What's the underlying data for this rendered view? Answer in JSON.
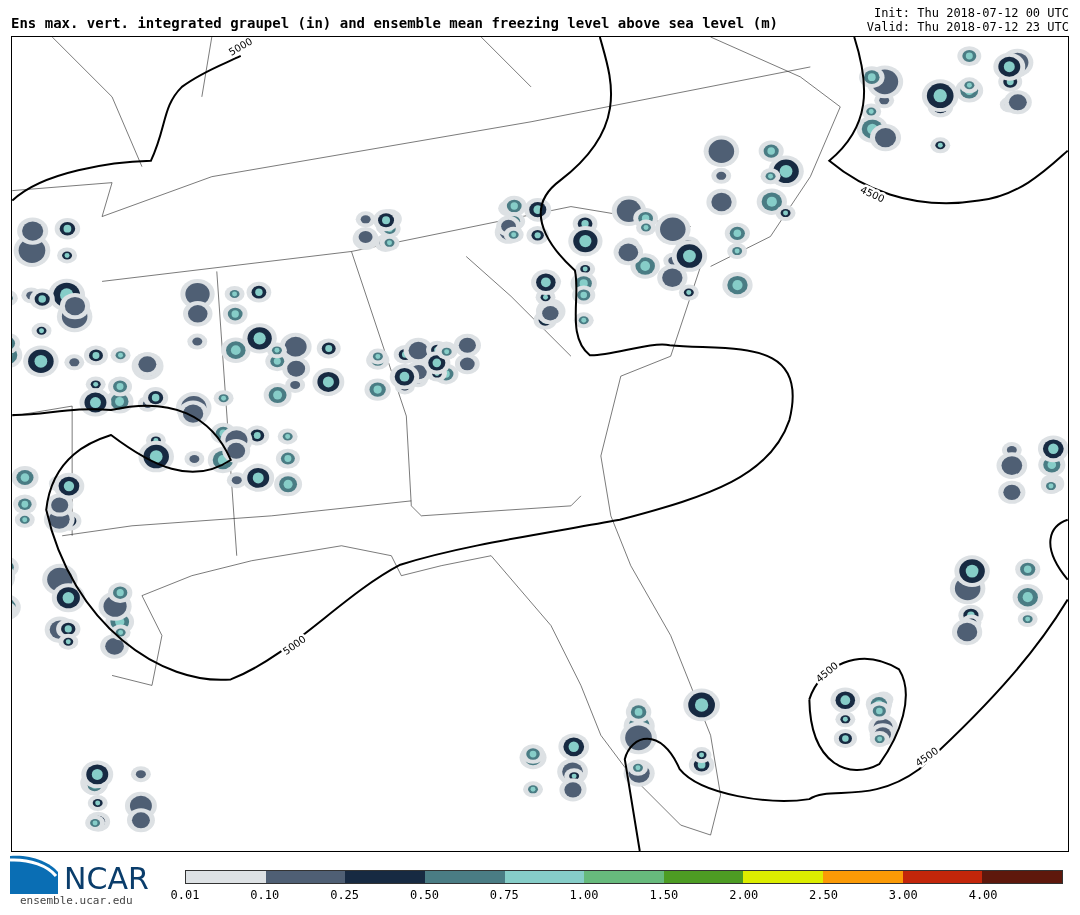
{
  "title": "Ens max. vert. integrated graupel (in) and ensemble mean freezing level above sea level (m)",
  "init": "Init: Thu 2018-07-12 00 UTC",
  "valid": "Valid: Thu 2018-07-12 23 UTC",
  "map": {
    "contour_labels": [
      {
        "text": "5000"
      },
      {
        "text": "4500"
      },
      {
        "text": "5000"
      },
      {
        "text": "4500"
      },
      {
        "text": "4500"
      }
    ]
  },
  "logo": {
    "name": "NCAR",
    "url": "ensemble.ucar.edu"
  },
  "colorbar": [
    {
      "label": "0.01",
      "color": "#dde1e4"
    },
    {
      "label": "0.10",
      "color": "#4f5f74"
    },
    {
      "label": "0.25",
      "color": "#172a42"
    },
    {
      "label": "0.50",
      "color": "#4a7c84"
    },
    {
      "label": "0.75",
      "color": "#86cdc8"
    },
    {
      "label": "1.00",
      "color": "#67ba7c"
    },
    {
      "label": "1.50",
      "color": "#4d9c23"
    },
    {
      "label": "2.00",
      "color": "#dced00"
    },
    {
      "label": "2.50",
      "color": "#fb9a06"
    },
    {
      "label": "3.00",
      "color": "#c3260a"
    },
    {
      "label": "4.00",
      "color": "#5e180c"
    }
  ]
}
